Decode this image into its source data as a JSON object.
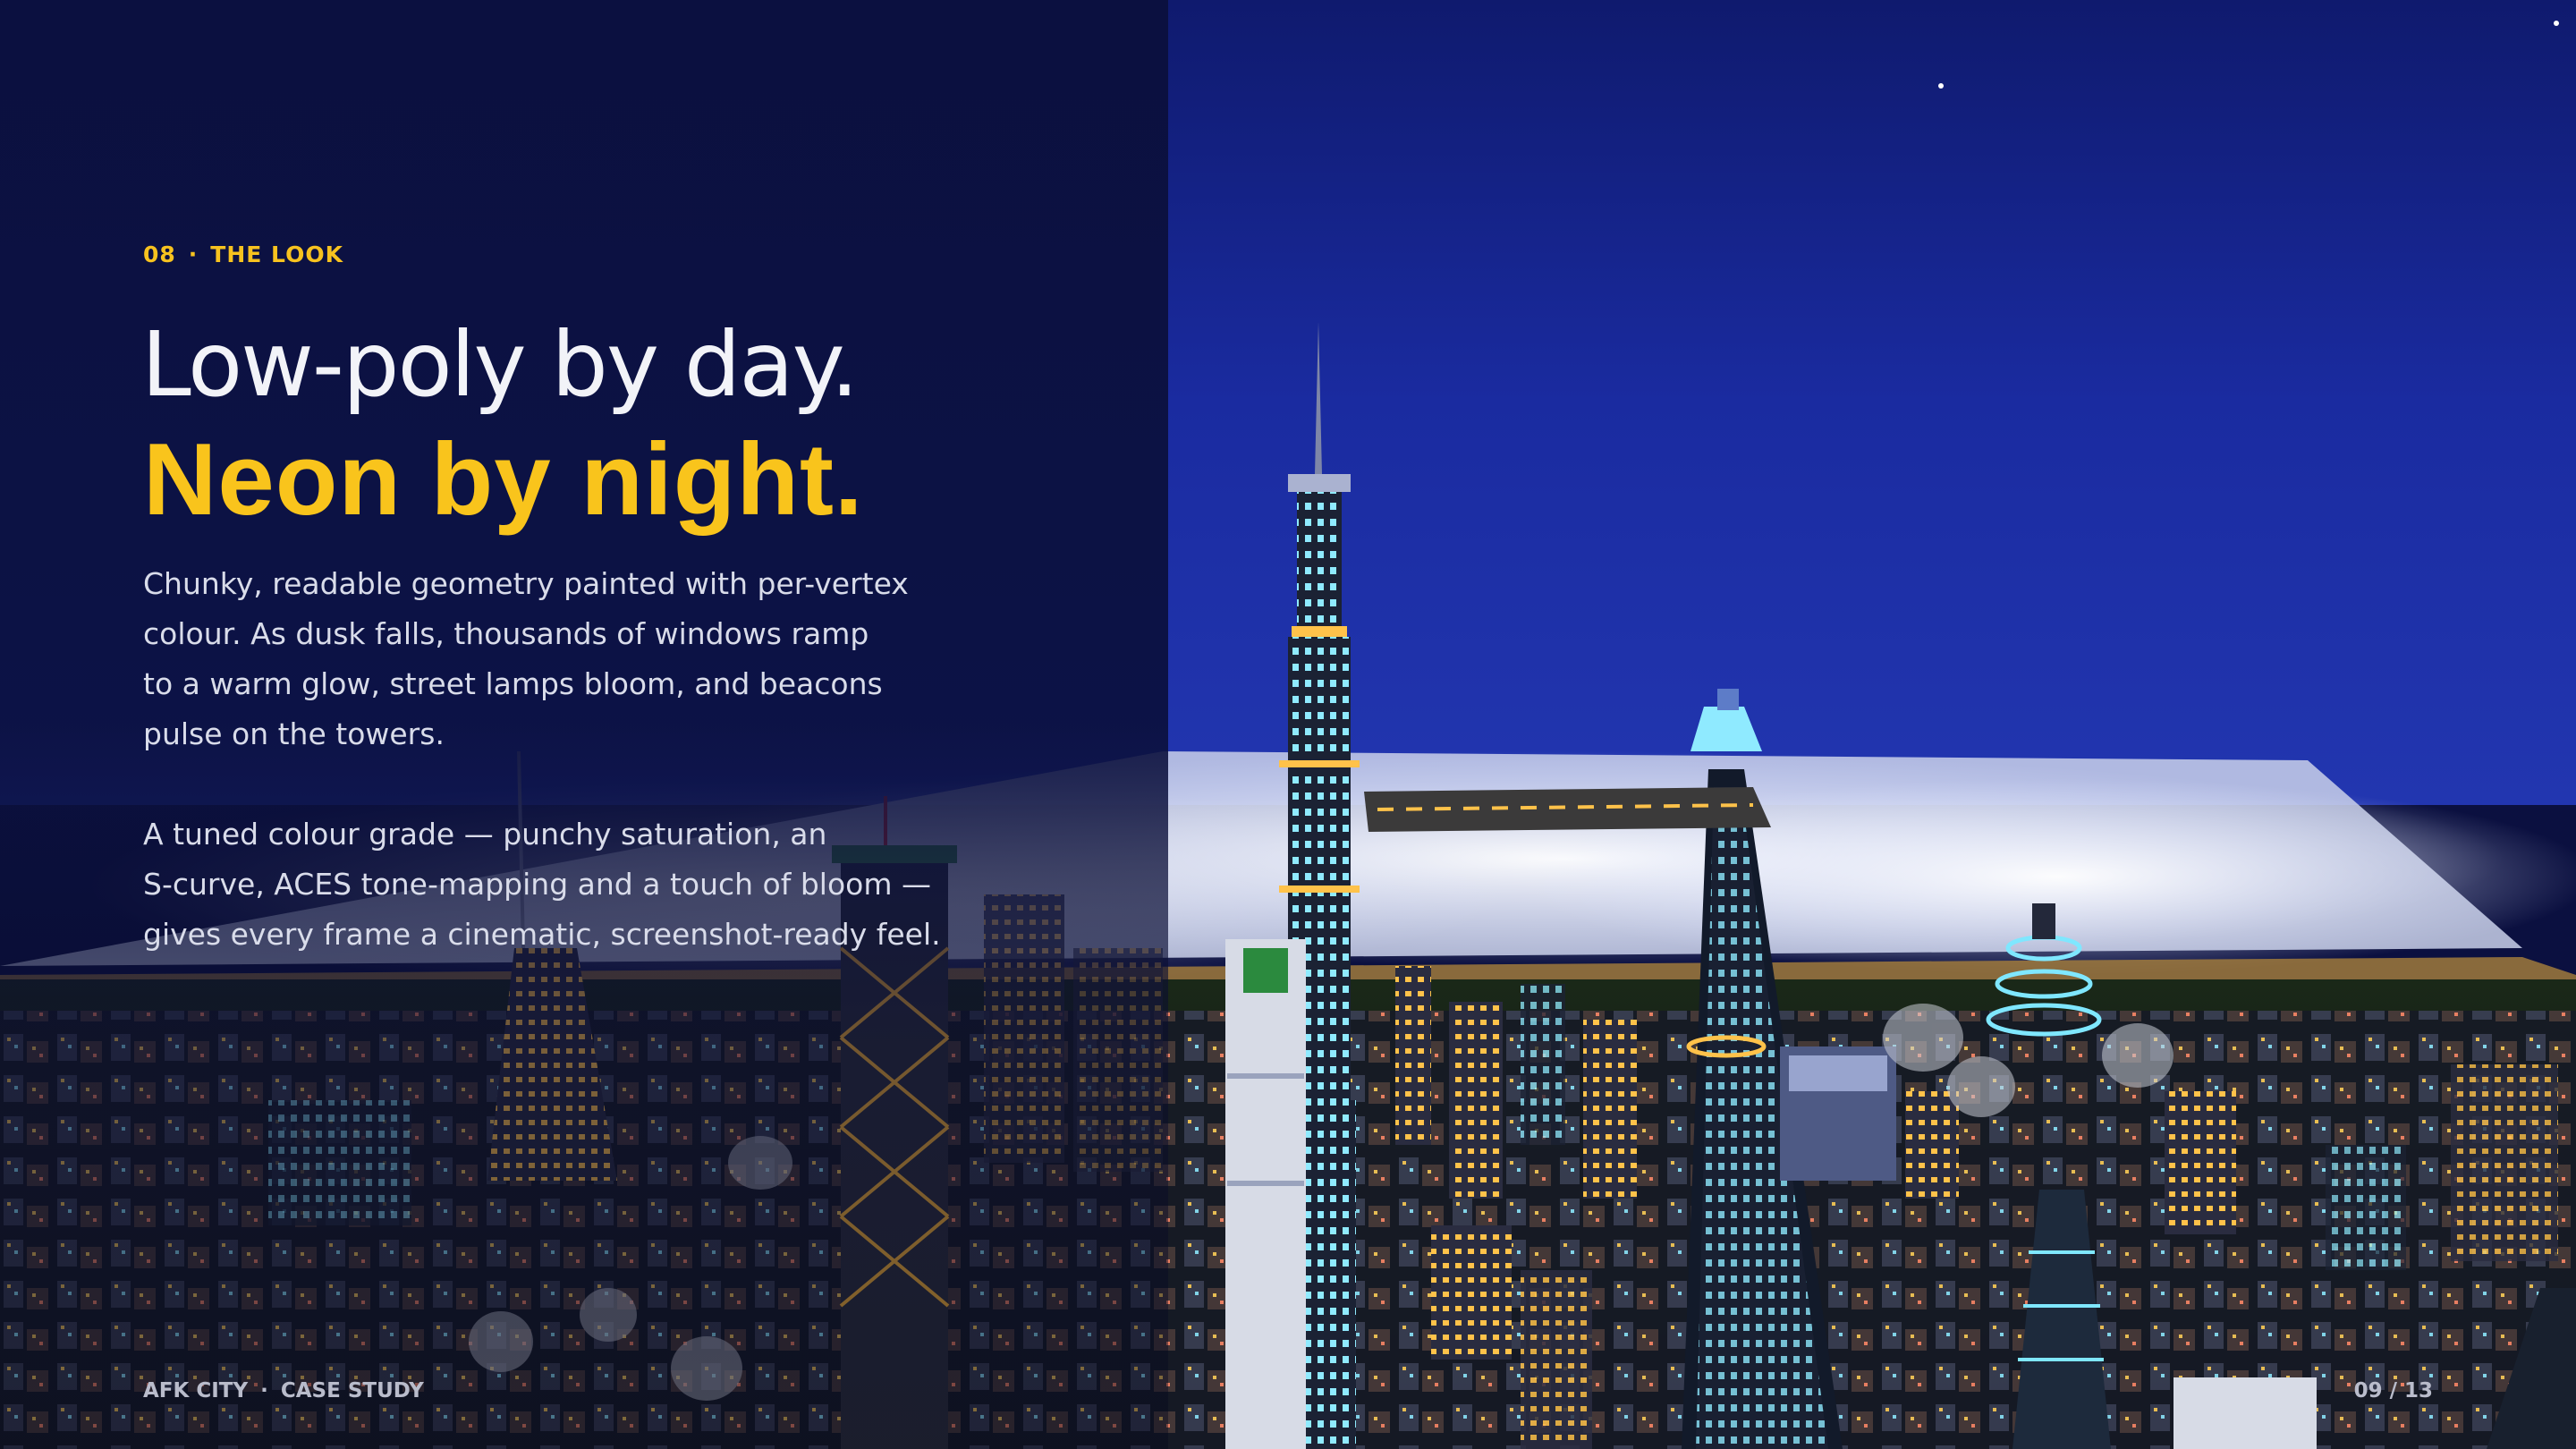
{
  "slide": {
    "section_number": "08",
    "section_title": "THE LOOK",
    "headline_line1": "Low-poly by day.",
    "headline_line2": "Neon by night.",
    "paragraph1": [
      "Chunky, readable geometry painted with per-vertex",
      "colour. As dusk falls, thousands of windows ramp",
      "to a warm glow, street lamps bloom, and beacons",
      "pulse on the towers."
    ],
    "paragraph2": [
      "A tuned colour grade — punchy saturation, an",
      "S-curve, ACES tone-mapping and a touch of bloom —",
      "gives every frame a cinematic, screenshot-ready feel."
    ],
    "footer_brand": "AFK CITY",
    "footer_label": "CASE STUDY",
    "page_indicator": "09 / 13",
    "separator": "·"
  },
  "colors": {
    "accent": "#f9c41c",
    "panel": "#0b1040",
    "sky": "#1a2a9e",
    "neon_cyan": "#7fe7ff",
    "window_warm": "#ffc24a"
  },
  "image": {
    "icon": "night-city-illustration"
  }
}
